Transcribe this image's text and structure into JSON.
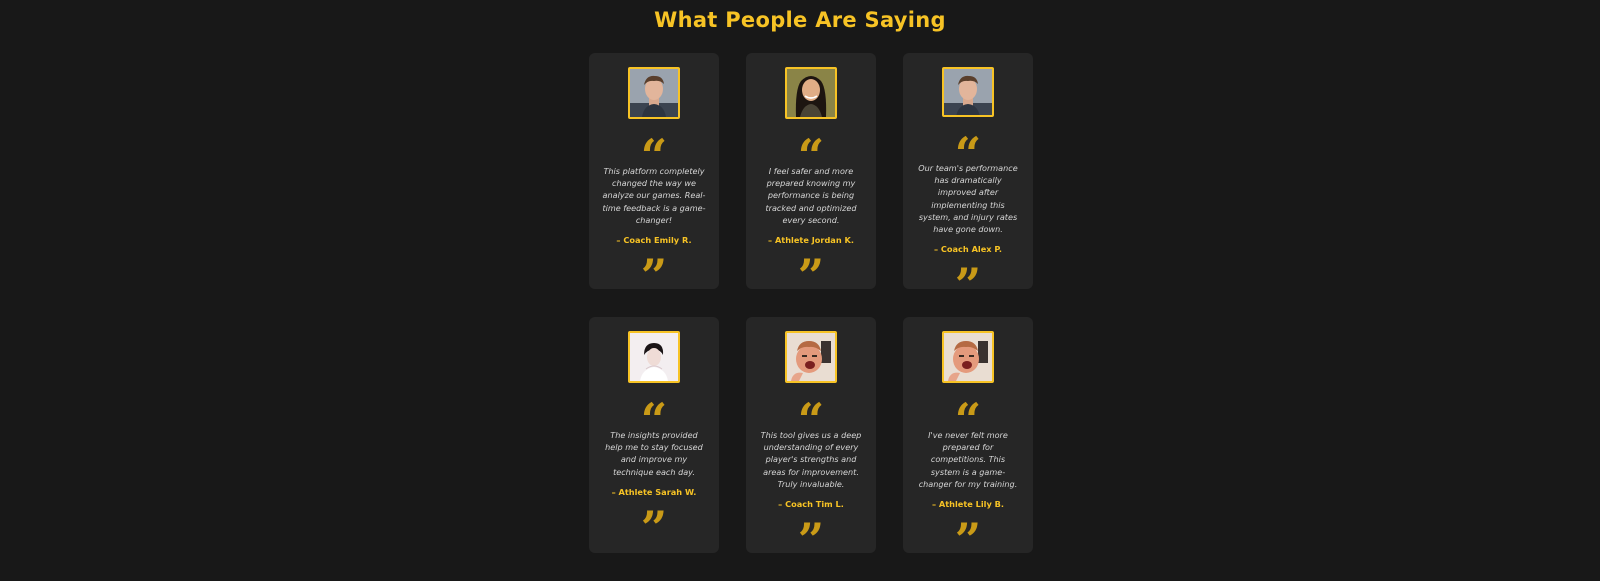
{
  "section": {
    "title": "What People Are Saying"
  },
  "testimonials": [
    {
      "quote": "This platform completely changed the way we analyze our games. Real-time feedback is a game-changer!",
      "author": "– Coach Emily R.",
      "avatar": "avatar-man-photo"
    },
    {
      "quote": "I feel safer and more prepared knowing my performance is being tracked and optimized every second.",
      "author": "– Athlete Jordan K.",
      "avatar": "avatar-woman-photo"
    },
    {
      "quote": "Our team's performance has dramatically improved after implementing this system, and injury rates have gone down.",
      "author": "– Coach Alex P.",
      "avatar": "avatar-man-photo"
    },
    {
      "quote": "The insights provided help me to stay focused and improve my technique each day.",
      "author": "– Athlete Sarah W.",
      "avatar": "avatar-person-white-background"
    },
    {
      "quote": "This tool gives us a deep understanding of every player's strengths and areas for improvement. Truly invaluable.",
      "author": "– Coach Tim L.",
      "avatar": "avatar-man-shouting-photo"
    },
    {
      "quote": "I've never felt more prepared for competitions. This system is a game-changer for my training.",
      "author": "– Athlete Lily B.",
      "avatar": "avatar-man-shouting-photo"
    }
  ],
  "glyphs": {
    "open_quote": "“",
    "close_quote": "”"
  },
  "colors": {
    "background": "#181818",
    "card": "#262626",
    "accent": "#f7c325",
    "quote_mark": "#c99a17",
    "text": "#d6d6d6"
  }
}
